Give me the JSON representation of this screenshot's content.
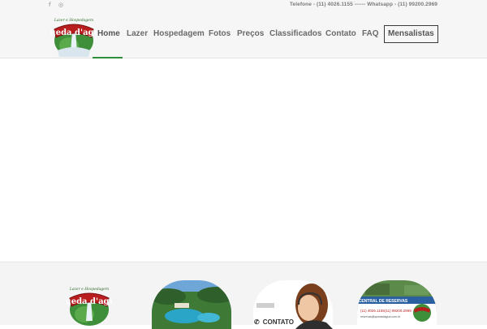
{
  "topbar": {
    "facebook_icon": "f",
    "instagram_icon": "◎",
    "contact_text": "Telefone - (11) 4026.1155 ------ Whatsapp - (11) 99200.2969"
  },
  "logo": {
    "small_text": "Lazer e Hospedagem",
    "brand": "Queda d'agua"
  },
  "nav": {
    "items": [
      "Home",
      "Lazer",
      "Hospedagem",
      "Fotos",
      "Preços",
      "Classificados",
      "Contato",
      "FAQ"
    ],
    "button": "Mensalistas",
    "active_index": 0
  },
  "footer": {
    "contact_label": "CONTATO",
    "phone_icon": "✆",
    "reserva_title": "CENTRAL DE RESERVAS",
    "reserva_phone1": "(11) 4026.1155",
    "reserva_phone2": "(11) 99200.2969",
    "reserva_email": "reservas@quedadagua.com.br"
  },
  "colors": {
    "accent_green": "#2e8f3a",
    "brand_red": "#b81e1e"
  }
}
